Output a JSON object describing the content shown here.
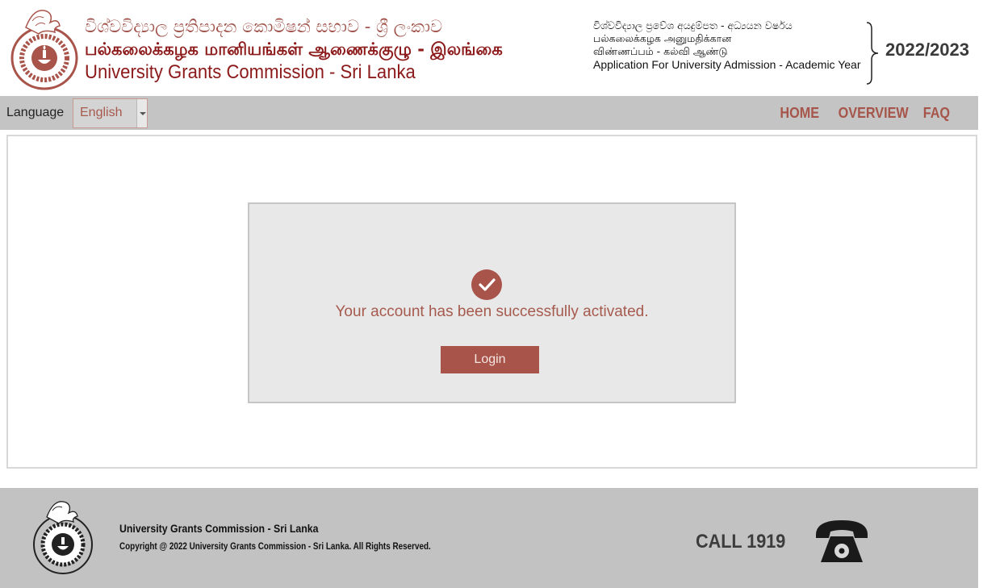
{
  "header": {
    "title_sinhala": "විශ්වවිද්‍යාල ප්‍රතිපාදන කොමිෂන් සභාව - ශ්‍රී ලංකාව",
    "title_tamil": "பல்கலைக்கழக மானியங்கள் ஆணைக்குழு - இலங்கை",
    "title_english": "University Grants Commission - Sri Lanka",
    "admission": {
      "line_sinhala": "විශ්වවිද්‍යාල ප්‍රවේශ අයදුම්පත - අධ්‍යයන වර්ෂය",
      "line_tamil_1": "பல்கலைக்கழக அனுமதிக்கான",
      "line_tamil_2": "விண்ணப்பம் - கல்வி ஆண்டு",
      "line_english": "Application For University Admission - Academic Year"
    },
    "year": "2022/2023"
  },
  "navbar": {
    "language_label": "Language",
    "language_selected": "English",
    "links": [
      "HOME",
      "OVERVIEW",
      "FAQ"
    ]
  },
  "main": {
    "message": "Your account has been successfully activated.",
    "login_label": "Login",
    "check_icon": "check-circle-icon"
  },
  "footer": {
    "org_name": "University Grants Commission - Sri Lanka",
    "copyright": "Copyright @ 2022 University Grants Commission - Sri Lanka. All Rights Reserved.",
    "call_text": "CALL 1919",
    "phone_icon": "telephone-icon"
  },
  "colors": {
    "accent": "#a8544a",
    "header_title": "#8c1a1a",
    "navbar_bg": "#c4c4c4",
    "footer_bg": "#c2c2c2"
  }
}
